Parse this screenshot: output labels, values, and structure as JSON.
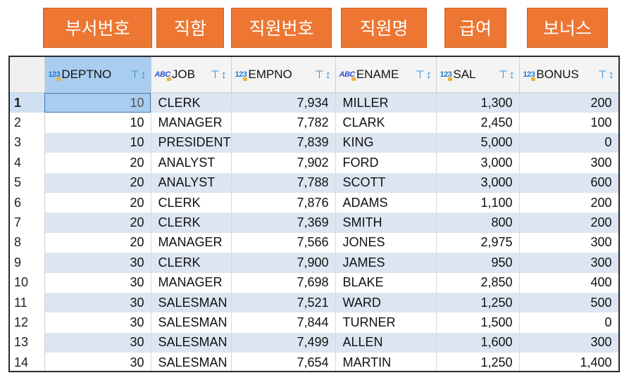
{
  "labels": [
    "부서번호",
    "직함",
    "직원번호",
    "직원명",
    "급여",
    "보너스"
  ],
  "columns": [
    {
      "name": "DEPTNO",
      "type": "123"
    },
    {
      "name": "JOB",
      "type": "ABC"
    },
    {
      "name": "EMPNO",
      "type": "123"
    },
    {
      "name": "ENAME",
      "type": "ABC"
    },
    {
      "name": "SAL",
      "type": "123"
    },
    {
      "name": "BONUS",
      "type": "123"
    }
  ],
  "rows": [
    {
      "n": "1",
      "deptno": "10",
      "job": "CLERK",
      "empno": "7,934",
      "ename": "MILLER",
      "sal": "1,300",
      "bonus": "200"
    },
    {
      "n": "2",
      "deptno": "10",
      "job": "MANAGER",
      "empno": "7,782",
      "ename": "CLARK",
      "sal": "2,450",
      "bonus": "100"
    },
    {
      "n": "3",
      "deptno": "10",
      "job": "PRESIDENT",
      "empno": "7,839",
      "ename": "KING",
      "sal": "5,000",
      "bonus": "0"
    },
    {
      "n": "4",
      "deptno": "20",
      "job": "ANALYST",
      "empno": "7,902",
      "ename": "FORD",
      "sal": "3,000",
      "bonus": "300"
    },
    {
      "n": "5",
      "deptno": "20",
      "job": "ANALYST",
      "empno": "7,788",
      "ename": "SCOTT",
      "sal": "3,000",
      "bonus": "600"
    },
    {
      "n": "6",
      "deptno": "20",
      "job": "CLERK",
      "empno": "7,876",
      "ename": "ADAMS",
      "sal": "1,100",
      "bonus": "200"
    },
    {
      "n": "7",
      "deptno": "20",
      "job": "CLERK",
      "empno": "7,369",
      "ename": "SMITH",
      "sal": "800",
      "bonus": "200"
    },
    {
      "n": "8",
      "deptno": "20",
      "job": "MANAGER",
      "empno": "7,566",
      "ename": "JONES",
      "sal": "2,975",
      "bonus": "300"
    },
    {
      "n": "9",
      "deptno": "30",
      "job": "CLERK",
      "empno": "7,900",
      "ename": "JAMES",
      "sal": "950",
      "bonus": "300"
    },
    {
      "n": "10",
      "deptno": "30",
      "job": "MANAGER",
      "empno": "7,698",
      "ename": "BLAKE",
      "sal": "2,850",
      "bonus": "400"
    },
    {
      "n": "11",
      "deptno": "30",
      "job": "SALESMAN",
      "empno": "7,521",
      "ename": "WARD",
      "sal": "1,250",
      "bonus": "500"
    },
    {
      "n": "12",
      "deptno": "30",
      "job": "SALESMAN",
      "empno": "7,844",
      "ename": "TURNER",
      "sal": "1,500",
      "bonus": "0"
    },
    {
      "n": "13",
      "deptno": "30",
      "job": "SALESMAN",
      "empno": "7,499",
      "ename": "ALLEN",
      "sal": "1,600",
      "bonus": "300"
    },
    {
      "n": "14",
      "deptno": "30",
      "job": "SALESMAN",
      "empno": "7,654",
      "ename": "MARTIN",
      "sal": "1,250",
      "bonus": "1,400"
    }
  ],
  "icons": {
    "filter": "filter-icon",
    "sort": "sort-icon",
    "type_number": "numeric-type-icon",
    "type_text": "text-type-icon"
  },
  "colors": {
    "label_bg": "#ec7632",
    "selected_header": "#a9cdee",
    "alt_row": "#dce6f2"
  }
}
